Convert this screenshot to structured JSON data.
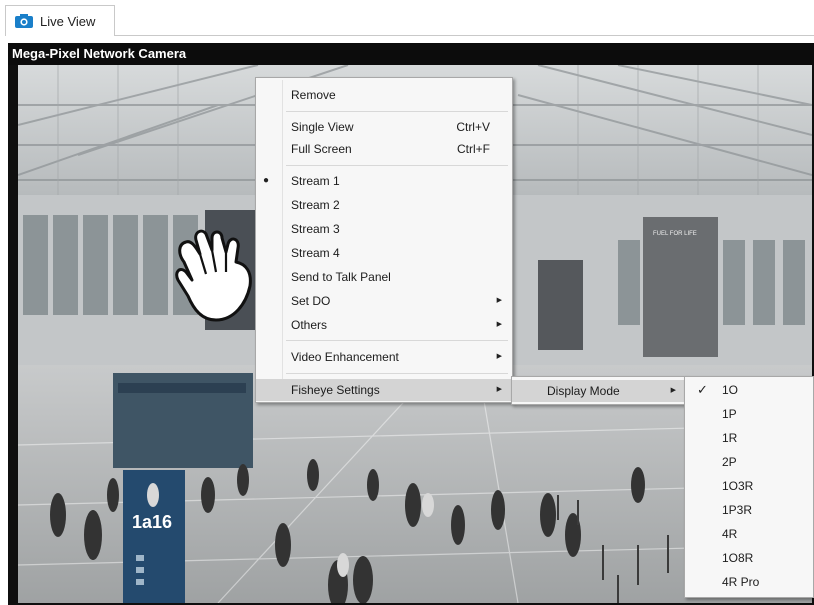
{
  "tab": {
    "label": "Live View",
    "icon": "camera-icon"
  },
  "panel": {
    "title": "Mega-Pixel Network Camera"
  },
  "context_menu": {
    "items": [
      {
        "label": "Remove"
      },
      {
        "label": "Single View",
        "shortcut": "Ctrl+V"
      },
      {
        "label": "Full Screen",
        "shortcut": "Ctrl+F"
      },
      {
        "label": "Stream 1",
        "selected": true
      },
      {
        "label": "Stream 2"
      },
      {
        "label": "Stream 3"
      },
      {
        "label": "Stream 4"
      },
      {
        "label": "Send to Talk Panel"
      },
      {
        "label": "Set DO",
        "has_submenu": true
      },
      {
        "label": "Others",
        "has_submenu": true
      },
      {
        "label": "Video Enhancement",
        "has_submenu": true
      },
      {
        "label": "Fisheye Settings",
        "has_submenu": true,
        "highlighted": true
      }
    ]
  },
  "fisheye_submenu": {
    "items": [
      {
        "label": "Display Mode",
        "has_submenu": true,
        "highlighted": true
      }
    ]
  },
  "display_mode_submenu": {
    "checked": "1O",
    "items": [
      "1O",
      "1P",
      "1R",
      "2P",
      "1O3R",
      "1P3R",
      "4R",
      "1O8R",
      "4R Pro"
    ]
  },
  "video_scene": {
    "sign_text": "1a16",
    "banner_text": "FUEL FOR LIFE"
  },
  "colors": {
    "title_bar": "#0c0c0c",
    "menu_bg": "#f7f7f7",
    "menu_highlight": "#d4d4d4",
    "camera_icon": "#1a7fc9"
  }
}
